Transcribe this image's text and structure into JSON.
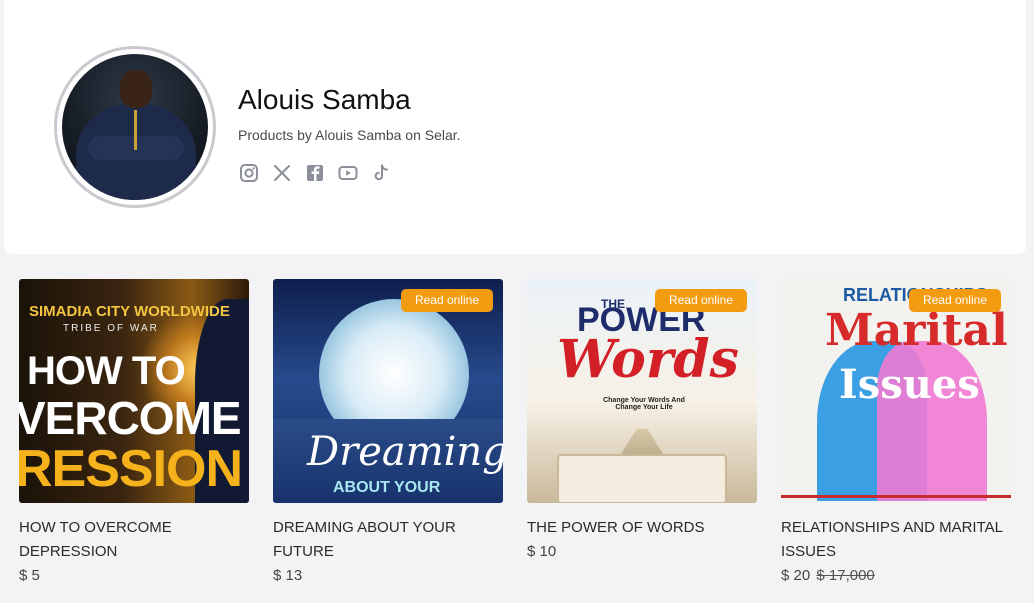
{
  "profile": {
    "name": "Alouis Samba",
    "subtitle": "Products by Alouis Samba on Selar.",
    "socials": [
      "instagram-icon",
      "x-icon",
      "facebook-icon",
      "youtube-icon",
      "tiktok-icon"
    ]
  },
  "colors": {
    "badge": "#f39c12",
    "background": "#f3f3f6",
    "card": "#ffffff"
  },
  "products": [
    {
      "title": "HOW TO OVERCOME DEPRESSION",
      "price": "$ 5",
      "badge": "",
      "cover": {
        "line1": "SIMADIA CITY WORLDWIDE",
        "line2": "TRIBE OF WAR",
        "line3": "HOW TO",
        "line4": "VERCOME",
        "line5": "RESSION"
      }
    },
    {
      "title": "DREAMING ABOUT YOUR FUTURE",
      "price": "$ 13",
      "badge": "Read online",
      "cover": {
        "line1": "Dreaming",
        "line2": "ABOUT YOUR"
      }
    },
    {
      "title": "THE POWER OF WORDS",
      "price": "$ 10",
      "badge": "Read online",
      "cover": {
        "line1": "THE",
        "line2": "POWER",
        "line3": "Words",
        "line4": "Change Your Words And Change Your Life"
      }
    },
    {
      "title": "RELATIONSHIPS AND MARITAL ISSUES",
      "price": "$ 20",
      "old_price": "$ 17,000",
      "badge": "Read online",
      "cover": {
        "line1": "RELATIONSHIPS",
        "line2": "Marital",
        "line3": "Issues"
      }
    }
  ]
}
